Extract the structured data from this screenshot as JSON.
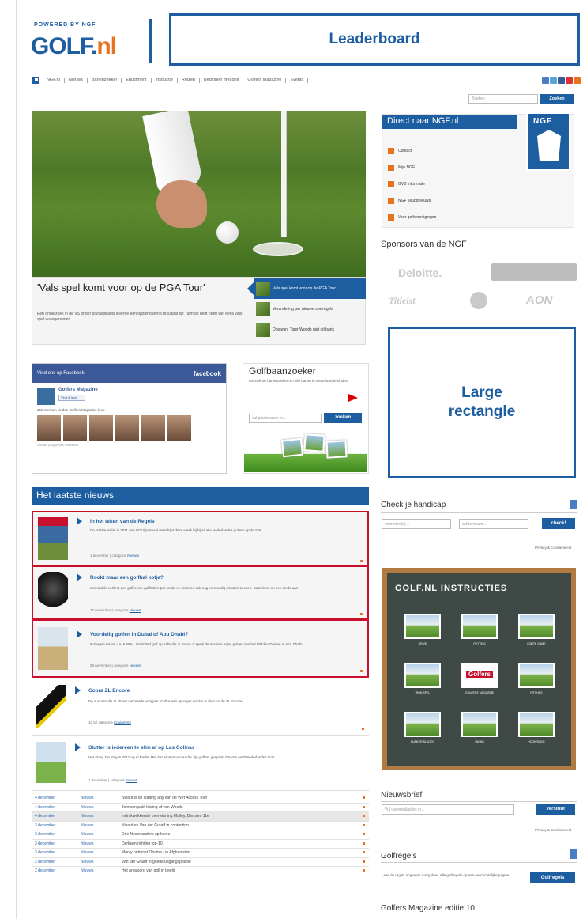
{
  "brand": {
    "powered_by": "POWERED BY NGF",
    "logo_text": "GOLF.",
    "logo_suffix": "nl"
  },
  "ads": {
    "leaderboard": "Leaderboard",
    "large_rectangle_line1": "Large",
    "large_rectangle_line2": "rectangle"
  },
  "nav": {
    "items": [
      "NGF.nl",
      "Nieuws",
      "Banenzoeker",
      "Equipment",
      "Instructie",
      "Reizen",
      "Beginnen met golf",
      "Golfers Magazine",
      "Events"
    ]
  },
  "search": {
    "placeholder": "Zoeken",
    "button": "Zoeken"
  },
  "hero": {
    "title": "'Vals spel komt voor op de PGA Tour'",
    "text": "Een onderzoek in de VS onder touraspirants leverde een opzienbarend resultaat op: ruim de helft heeft wel eens vals spel waargenomen.",
    "side_items": [
      "Vals spel komt voor op de PGA Tour",
      "Verandering per nieuwe spelregels",
      "Opsteun: Tiger Woods niet uit bank"
    ]
  },
  "ngf": {
    "heading": "Direct naar NGF.nl",
    "logo_text": "NGF",
    "links": [
      "Contact",
      "Mijn NGF",
      "GVB informatie",
      "NGF Jeugdnieuws",
      "Voor golfverenigingen"
    ]
  },
  "sponsors": {
    "title": "Sponsors van de NGF",
    "names": [
      "Deloitte.",
      "Titleist",
      "AON"
    ]
  },
  "facebook": {
    "header": "Vind ons op Facebook",
    "brand": "facebook",
    "page_name": "Golfers Magazine",
    "like": "Vind ik leuk",
    "count_text": "350 mensen vinden Golfers Magazine leuk.",
    "plugin": "Sociale plug-in van Facebook"
  },
  "banenzoeker": {
    "title": "Golfbaanzoeker",
    "text": "Gebruik de banenzoeker om alle banen in Nederland te vinden!",
    "placeholder": "vul plaatsnaam in...",
    "button": "zoeken"
  },
  "news": {
    "heading": "Het laatste nieuws",
    "featured": [
      {
        "title": "In het teken van de Regels",
        "text": "De laatste editie in 2011 van GOLFjournaal verschijnt deze week bij bijna alle Nederlandse golfers op de mat.",
        "date": "1 december",
        "cat_label": "categorie",
        "cat": "Nieuws"
      },
      {
        "title": "Rookt maar een golfbal kotje?",
        "text": "Gemiddeld verliest een golfer vier golfballen per ronde en hiermee ook nog eenvoudig minuten zoeken. Daar komt nu een einde aan.",
        "date": "27 november",
        "cat_label": "categorie",
        "cat": "Nieuws"
      },
      {
        "title": "Voordelig golfen in Dubai of Abu Dhabi?",
        "text": "5-daagse reizen v.a. € 599,-. Unlimited golf op Al Badia in Dubai of speel de mooiste vrijes golven van het Midden Oosten in Abu Dhabi",
        "date": "29 november",
        "cat_label": "categorie",
        "cat": "Nieuws"
      }
    ],
    "plain": [
      {
        "title": "Cobra ZL Encore",
        "text": "De succesvolle ZL driver verkeerde vorigjaar. Cobra een opvolger en dus is daar nu de ZL Encore.",
        "date": "10.5",
        "cat_label": "categorie",
        "cat": "Equipment"
      },
      {
        "title": "Slutter is iedereen te slim af op Las Colinas",
        "text": "Het sloeg zijn slag in 2011 op Al Badia. Met het winnen van Andre zijn golfers gesprek. Daarna wedt Nederlandse tooit.",
        "date": "1 december",
        "cat_label": "categorie",
        "cat": "Nieuws"
      }
    ],
    "list": [
      {
        "date": "4 december",
        "cat": "Nieuws",
        "title": "Nivard is de leading ady van de Wet Access Tour"
      },
      {
        "date": "4 december",
        "cat": "Nieuws",
        "title": "Johnson pakt leiding af van Woods"
      },
      {
        "date": "4 december",
        "cat": "Nieuws",
        "title": "Indrukwekkende overwinning Molloy, Derksen 11e"
      },
      {
        "date": "3 december",
        "cat": "Nieuws",
        "title": "Nivard en Van der Graaff in contention"
      },
      {
        "date": "3 december",
        "cat": "Nieuws",
        "title": "Drie Nederlanders op koers"
      },
      {
        "date": "3 december",
        "cat": "Nieuws",
        "title": "Derksen richting top-10"
      },
      {
        "date": "3 december",
        "cat": "Nieuws",
        "title": "Monty ontmoet Obama - in Afghanistan"
      },
      {
        "date": "2 december",
        "cat": "Nieuws",
        "title": "Van der Graaff in goede uitgangspositie"
      },
      {
        "date": "2 december",
        "cat": "Nieuws",
        "title": "Het antwoord van golf in beeld"
      }
    ]
  },
  "handicap": {
    "title": "Check je handicap",
    "ph1": "voorletter(s)...",
    "ph2": "achternaam...",
    "button": "check!",
    "privacy": "Privacy & Cookiebeleid"
  },
  "instructies": {
    "title": "GOLF.NL INSTRUCTIES",
    "tiles": [
      "DRIVE",
      "PUTTING",
      "KORTE GAME",
      "IRON SPEL",
      "GOLFERS MAGAZINE",
      "PITCHES",
      "BUNKER SLAGEN",
      "SWING",
      "HOOK/SLICE"
    ]
  },
  "nieuwsbrief": {
    "title": "Nieuwsbrief",
    "placeholder": "Vul uw emailadres in...",
    "button": "verstuur",
    "privacy": "Privacy & Cookiebeleid"
  },
  "golfregels": {
    "title": "Golfregels",
    "text": "Lees de regels nog eens rustig door. Alle golfregels op een overzichtelijke pagina.",
    "button": "Golfregels"
  },
  "magazine": {
    "title": "Golfers Magazine editie 10"
  },
  "colors": {
    "brand_blue": "#1d5ea0",
    "accent_orange": "#e8731e",
    "highlight_red": "#c8102e",
    "facebook_blue": "#3b5998"
  }
}
